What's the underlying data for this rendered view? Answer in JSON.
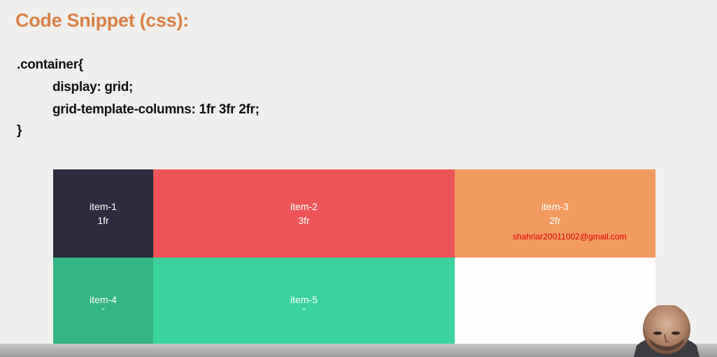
{
  "slide": {
    "title": "Code Snippet (css):"
  },
  "code": {
    "lines": [
      ".container{",
      "display: grid;",
      "grid-template-columns: 1fr 3fr 2fr;",
      "}"
    ]
  },
  "grid_items": [
    {
      "name": "item-1",
      "size": "1fr",
      "color": "#2c2c3e"
    },
    {
      "name": "item-2",
      "size": "3fr",
      "color": "#ee5559"
    },
    {
      "name": "item-3",
      "size": "2fr",
      "color": "#f29b60"
    },
    {
      "name": "item-4",
      "size": "\"",
      "color": "#33b584"
    },
    {
      "name": "item-5",
      "size": "\"",
      "color": "#3bd39d"
    }
  ],
  "watermark": {
    "email": "shahriar20011002@gmail.com"
  },
  "presenter": {
    "icon": "presenter-webcam-icon"
  }
}
